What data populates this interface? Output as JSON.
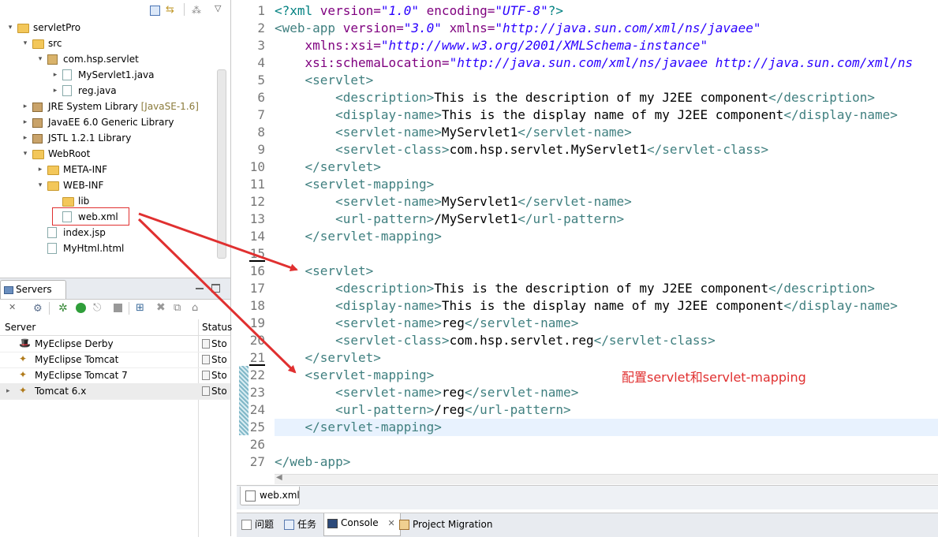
{
  "project_explorer": {
    "rows": [
      {
        "label": "servletPro",
        "extra": ""
      },
      {
        "label": "src",
        "extra": ""
      },
      {
        "label": "com.hsp.servlet",
        "extra": ""
      },
      {
        "label": "MyServlet1.java",
        "extra": ""
      },
      {
        "label": "reg.java",
        "extra": ""
      },
      {
        "label": "JRE System Library",
        "extra": "[JavaSE-1.6]"
      },
      {
        "label": "JavaEE 6.0 Generic Library",
        "extra": ""
      },
      {
        "label": "JSTL 1.2.1 Library",
        "extra": ""
      },
      {
        "label": "WebRoot",
        "extra": ""
      },
      {
        "label": "META-INF",
        "extra": ""
      },
      {
        "label": "WEB-INF",
        "extra": ""
      },
      {
        "label": "lib",
        "extra": ""
      },
      {
        "label": "web.xml",
        "extra": ""
      },
      {
        "label": "index.jsp",
        "extra": ""
      },
      {
        "label": "MyHtml.html",
        "extra": ""
      }
    ]
  },
  "servers_view": {
    "tab_label": "Servers",
    "col_server": "Server",
    "col_status": "Status",
    "rows": [
      {
        "name": "MyEclipse Derby",
        "status": "Sto"
      },
      {
        "name": "MyEclipse Tomcat",
        "status": "Sto"
      },
      {
        "name": "MyEclipse Tomcat 7",
        "status": "Sto"
      },
      {
        "name": "Tomcat  6.x",
        "status": "Sto"
      }
    ]
  },
  "editor": {
    "line_numbers": [
      "1",
      "2",
      "3",
      "4",
      "5",
      "6",
      "7",
      "8",
      "9",
      "10",
      "11",
      "12",
      "13",
      "14",
      "15",
      "16",
      "17",
      "18",
      "19",
      "20",
      "21",
      "22",
      "23",
      "24",
      "25",
      "26",
      "27"
    ],
    "lines": [
      [
        {
          "t": "<?xml ",
          "c": "decl"
        },
        {
          "t": "version=",
          "c": "attr"
        },
        {
          "t": "\"1.0\"",
          "c": "val"
        },
        {
          "t": " encoding=",
          "c": "attr"
        },
        {
          "t": "\"UTF-8\"",
          "c": "val"
        },
        {
          "t": "?>",
          "c": "decl"
        }
      ],
      [
        {
          "t": "<web-app ",
          "c": "tag"
        },
        {
          "t": "version=",
          "c": "attr"
        },
        {
          "t": "\"3.0\"",
          "c": "val"
        },
        {
          "t": " xmlns=",
          "c": "attr"
        },
        {
          "t": "\"http://java.sun.com/xml/ns/javaee\"",
          "c": "val"
        }
      ],
      [
        {
          "t": "    xmlns:xsi=",
          "c": "attr"
        },
        {
          "t": "\"http://www.w3.org/2001/XMLSchema-instance\"",
          "c": "val"
        }
      ],
      [
        {
          "t": "    xsi:schemaLocation=",
          "c": "attr"
        },
        {
          "t": "\"http://java.sun.com/xml/ns/javaee http://java.sun.com/xml/ns",
          "c": "val"
        }
      ],
      [
        {
          "t": "    <servlet>",
          "c": "tag"
        }
      ],
      [
        {
          "t": "        <description>",
          "c": "tag"
        },
        {
          "t": "This is the description of my J2EE component",
          "c": "txt"
        },
        {
          "t": "</description>",
          "c": "tag"
        }
      ],
      [
        {
          "t": "        <display-name>",
          "c": "tag"
        },
        {
          "t": "This is the display name of my J2EE component",
          "c": "txt"
        },
        {
          "t": "</display-name>",
          "c": "tag"
        }
      ],
      [
        {
          "t": "        <servlet-name>",
          "c": "tag"
        },
        {
          "t": "MyServlet1",
          "c": "txt"
        },
        {
          "t": "</servlet-name>",
          "c": "tag"
        }
      ],
      [
        {
          "t": "        <servlet-class>",
          "c": "tag"
        },
        {
          "t": "com.hsp.servlet.MyServlet1",
          "c": "txt"
        },
        {
          "t": "</servlet-class>",
          "c": "tag"
        }
      ],
      [
        {
          "t": "    </servlet>",
          "c": "tag"
        }
      ],
      [
        {
          "t": "    <servlet-mapping>",
          "c": "tag"
        }
      ],
      [
        {
          "t": "        <servlet-name>",
          "c": "tag"
        },
        {
          "t": "MyServlet1",
          "c": "txt"
        },
        {
          "t": "</servlet-name>",
          "c": "tag"
        }
      ],
      [
        {
          "t": "        <url-pattern>",
          "c": "tag"
        },
        {
          "t": "/MyServlet1",
          "c": "txt"
        },
        {
          "t": "</url-pattern>",
          "c": "tag"
        }
      ],
      [
        {
          "t": "    </servlet-mapping>",
          "c": "tag"
        }
      ],
      [],
      [
        {
          "t": "    <servlet>",
          "c": "tag"
        }
      ],
      [
        {
          "t": "        <description>",
          "c": "tag"
        },
        {
          "t": "This is the description of my J2EE component",
          "c": "txt"
        },
        {
          "t": "</description>",
          "c": "tag"
        }
      ],
      [
        {
          "t": "        <display-name>",
          "c": "tag"
        },
        {
          "t": "This is the display name of my J2EE component",
          "c": "txt"
        },
        {
          "t": "</display-name>",
          "c": "tag"
        }
      ],
      [
        {
          "t": "        <servlet-name>",
          "c": "tag"
        },
        {
          "t": "reg",
          "c": "txt"
        },
        {
          "t": "</servlet-name>",
          "c": "tag"
        }
      ],
      [
        {
          "t": "        <servlet-class>",
          "c": "tag"
        },
        {
          "t": "com.hsp.servlet.reg",
          "c": "txt"
        },
        {
          "t": "</servlet-class>",
          "c": "tag"
        }
      ],
      [
        {
          "t": "    </servlet>",
          "c": "tag"
        }
      ],
      [
        {
          "t": "    <servlet-mapping>",
          "c": "tag"
        }
      ],
      [
        {
          "t": "        <servlet-name>",
          "c": "tag"
        },
        {
          "t": "reg",
          "c": "txt"
        },
        {
          "t": "</servlet-name>",
          "c": "tag"
        }
      ],
      [
        {
          "t": "        <url-pattern>",
          "c": "tag"
        },
        {
          "t": "/reg",
          "c": "txt"
        },
        {
          "t": "</url-pattern>",
          "c": "tag"
        }
      ],
      [
        {
          "t": "    </servlet-mapping>",
          "c": "tag"
        }
      ],
      [],
      [
        {
          "t": "</web-app>",
          "c": "tag"
        }
      ]
    ],
    "tab_label": "web.xml",
    "annotation": "配置servlet和servlet-mapping"
  },
  "bottom_tabs": {
    "problems": "问题",
    "tasks": "任务",
    "console": "Console",
    "migration": "Project Migration"
  },
  "colors": {
    "tag": "#3f7f7f",
    "attribute": "#7f007f",
    "value": "#2a00ff",
    "annotation": "#e03030"
  }
}
